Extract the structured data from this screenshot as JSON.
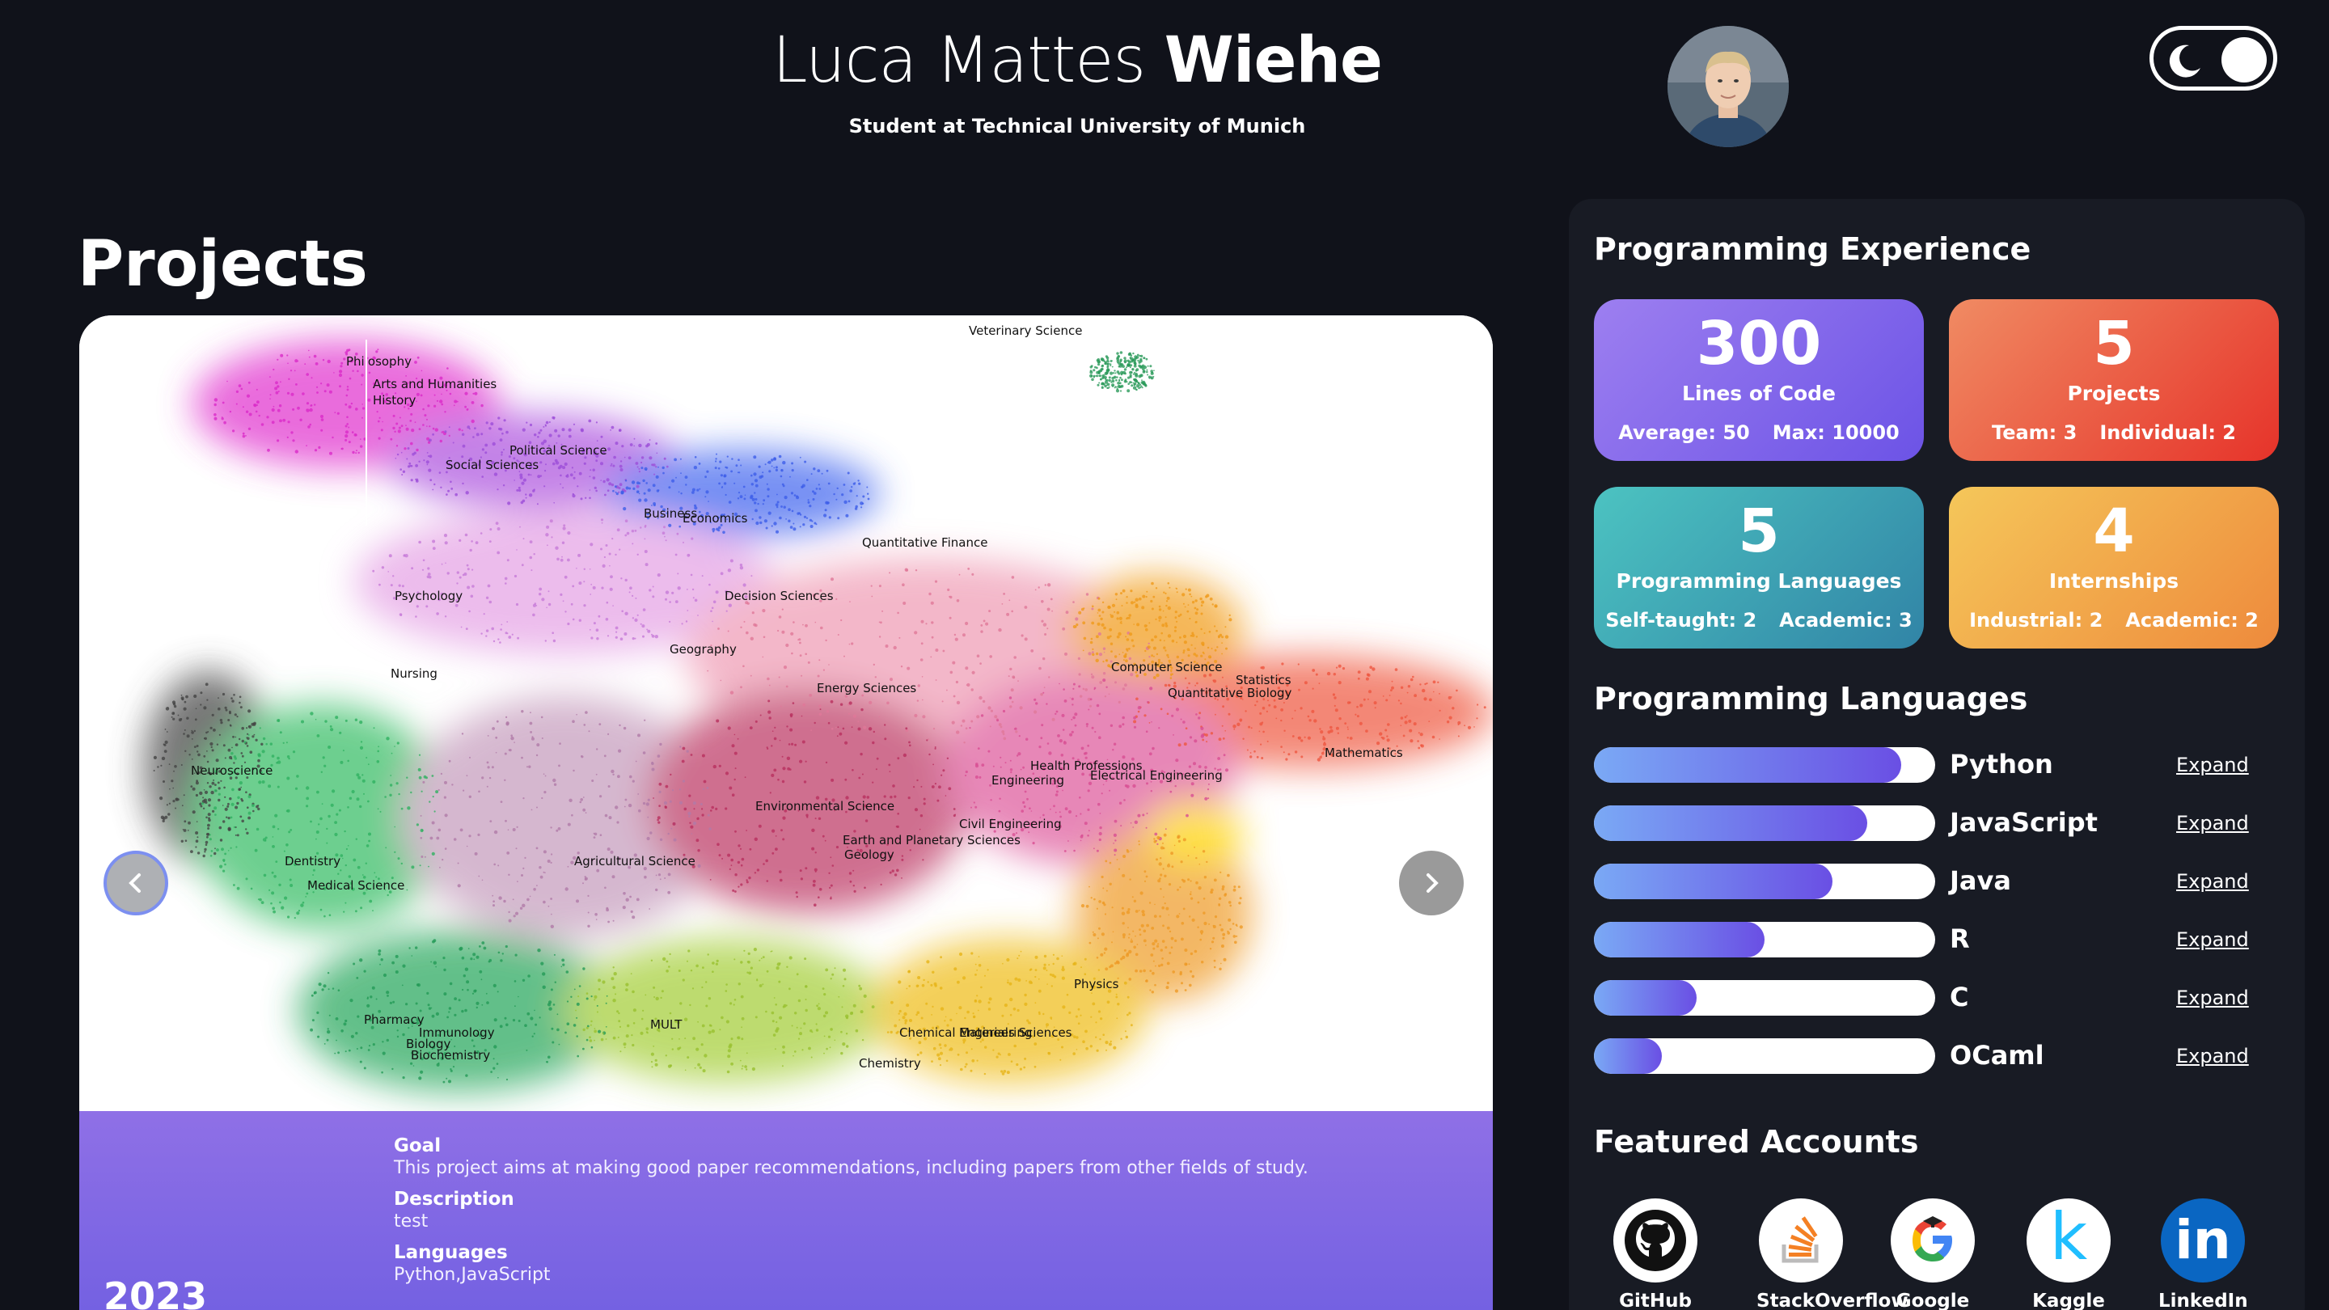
{
  "header": {
    "first_names": "Luca Mattes",
    "last_name": "Wiehe",
    "subtitle": "Student at Technical University of Munich"
  },
  "projects": {
    "title": "Projects",
    "current": {
      "year": "2023",
      "goal_heading": "Goal",
      "goal_text": "This project aims at making good paper recommendations, including papers from other fields of study.",
      "description_heading": "Description",
      "description_text": "test",
      "languages_heading": "Languages",
      "languages_text": "Python,JavaScript",
      "map_labels": [
        "Veterinary Science",
        "Philosophy",
        "Arts and Humanities",
        "History",
        "Political Science",
        "Social Sciences",
        "Business",
        "Economics",
        "Quantitative Finance",
        "Psychology",
        "Decision Sciences",
        "Geography",
        "Nursing",
        "Energy Sciences",
        "Computer Science",
        "Statistics",
        "Quantitative Biology",
        "Mathematics",
        "Neuroscience",
        "Health Professions",
        "Engineering",
        "Electrical Engineering",
        "Environmental Science",
        "Civil Engineering",
        "Earth and Planetary Sciences",
        "Geology",
        "Dentistry",
        "Agricultural Science",
        "Medical Science",
        "Physics",
        "Pharmacy",
        "Immunology",
        "Biology",
        "Biochemistry",
        "MULT",
        "Chemical Engineering",
        "Materials Sciences",
        "Chemistry"
      ]
    }
  },
  "experience": {
    "title": "Programming Experience",
    "cards": {
      "lines": {
        "value": "300",
        "label": "Lines of Code",
        "sub1": "Average: 50",
        "sub2": "Max: 10000"
      },
      "projects": {
        "value": "5",
        "label": "Projects",
        "sub1": "Team: 3",
        "sub2": "Individual: 2"
      },
      "languages": {
        "value": "5",
        "label": "Programming Languages",
        "sub1": "Self-taught: 2",
        "sub2": "Academic: 3"
      },
      "internships": {
        "value": "4",
        "label": "Internships",
        "sub1": "Industrial: 2",
        "sub2": "Academic: 2"
      }
    }
  },
  "languages": {
    "title": "Programming Languages",
    "expand_label": "Expand",
    "items": [
      {
        "name": "Python",
        "level": 0.9
      },
      {
        "name": "JavaScript",
        "level": 0.8
      },
      {
        "name": "Java",
        "level": 0.7
      },
      {
        "name": "R",
        "level": 0.5
      },
      {
        "name": "C",
        "level": 0.3
      },
      {
        "name": "OCaml",
        "level": 0.2
      }
    ]
  },
  "accounts": {
    "title": "Featured Accounts",
    "items": [
      {
        "label": "GitHub",
        "icon": "github-icon"
      },
      {
        "label": "StackOverflow",
        "icon": "stackoverflow-icon"
      },
      {
        "label": "Google",
        "icon": "google-icon"
      },
      {
        "label": "Kaggle",
        "icon": "kaggle-icon"
      },
      {
        "label": "LinkedIn",
        "icon": "linkedin-icon"
      }
    ]
  },
  "colors": {
    "background": "#10121a",
    "panel": "#181b24",
    "accent_purple": "#7461e2",
    "bar_gradient_start": "#7aa9f5",
    "bar_gradient_end": "#6a4fe4"
  }
}
